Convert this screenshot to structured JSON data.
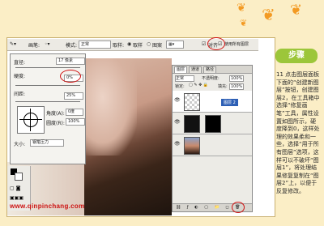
{
  "toolbar": {
    "brush_label": "画笔:",
    "mode_label": "模式:",
    "mode_value": "正常",
    "sample_label": "取样:",
    "sample_option_1": "取样",
    "sample_option_2": "图案",
    "aligned_label": "对齐",
    "all_layers_label": "使用所有图层"
  },
  "brush_popup": {
    "diameter_label": "直径:",
    "diameter_value": "17 像素",
    "hardness_label": "硬度:",
    "hardness_value": "0%",
    "spacing_label": "间距:",
    "spacing_value": "25%",
    "angle_label": "角度(A):",
    "angle_value": "0度",
    "roundness_label": "圆度(R):",
    "roundness_value": "100%",
    "size_label": "大小:",
    "size_value": "钢笔压力"
  },
  "layers_panel": {
    "tabs": [
      "图层",
      "通道",
      "路径"
    ],
    "blend_mode": "正常",
    "opacity_label": "不透明度:",
    "opacity_value": "100%",
    "lock_label": "锁定:",
    "fill_label": "填充:",
    "fill_value": "100%",
    "layers": [
      {
        "name": "图层 2",
        "selected": true
      },
      {
        "name": "",
        "selected": false
      },
      {
        "name": "",
        "selected": false
      }
    ]
  },
  "side": {
    "step_label": "步骤",
    "description": "11 点击图层面板下面的“创建新图层”按钮，创建图层2，在工具箱中选择“修复画笔”工具，属性设置如图所示，硬度降到0，这样处理的效果柔和一些，选择“用于所有图层”选项，这样可以不破坏“图层1”，将处理结果修复复制在“图层2”上，以便于反复修改。"
  },
  "watermark_url": "www.qinpinchang.com",
  "colors": {
    "accent_red": "#d01010",
    "step_green": "#9cc63a",
    "background": "#fbeec6"
  }
}
